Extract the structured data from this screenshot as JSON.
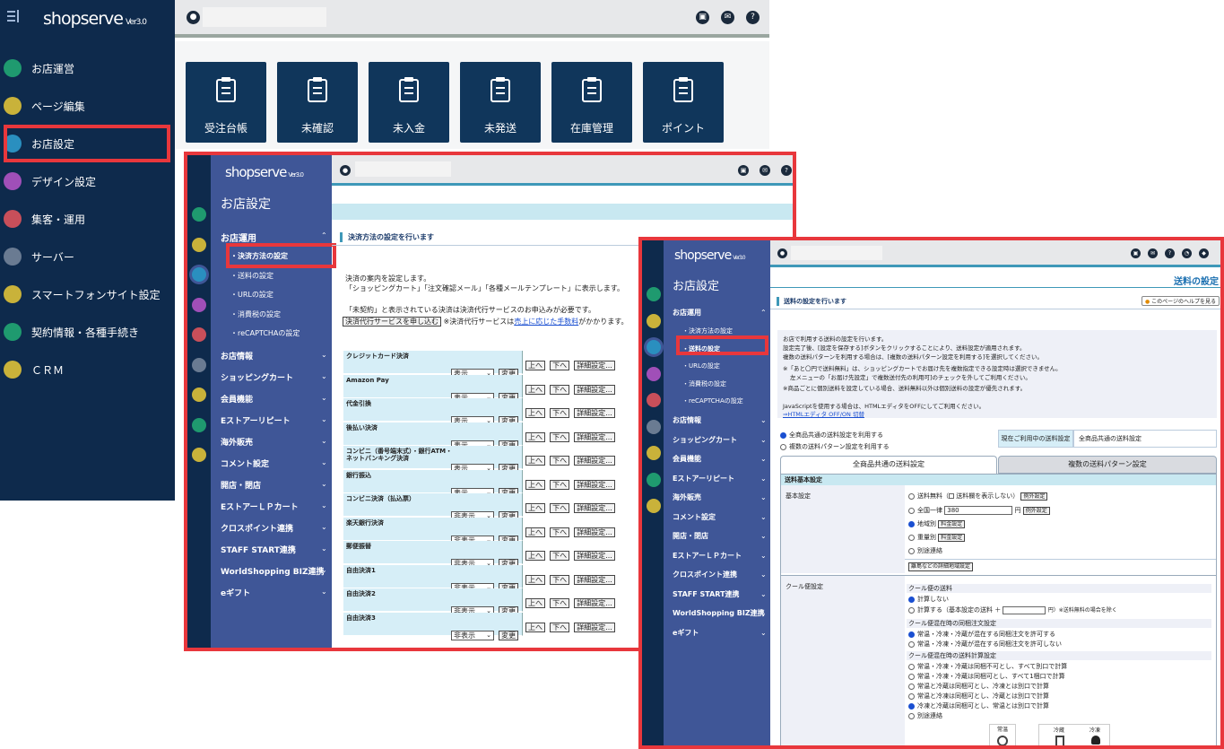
{
  "main": {
    "logo": "shopserve",
    "logo_ver": "Ver3.0",
    "sidebar": [
      {
        "label": "お店運営",
        "color": "#1f9a6f"
      },
      {
        "label": "ページ編集",
        "color": "#c9b23a"
      },
      {
        "label": "お店設定",
        "color": "#2a8fbf"
      },
      {
        "label": "デザイン設定",
        "color": "#a04fb8"
      },
      {
        "label": "集客・運用",
        "color": "#c84f5a"
      },
      {
        "label": "サーバー",
        "color": "#6a7b92"
      },
      {
        "label": "スマートフォンサイト設定",
        "color": "#c9b23a"
      },
      {
        "label": "契約情報・各種手続き",
        "color": "#1f9a6f"
      },
      {
        "label": "ＣＲＭ",
        "color": "#c9b23a"
      }
    ],
    "tiles": [
      "受注台帳",
      "未確認",
      "未入金",
      "未発送",
      "在庫管理",
      "ポイント"
    ]
  },
  "s1": {
    "logo": "shopserve",
    "logo_ver": "Ver3.0",
    "section": "お店設定",
    "group": "お店運用",
    "sub": [
      "決済方法の設定",
      "送料の設定",
      "URLの設定",
      "消費税の設定",
      "reCAPTCHAの設定"
    ],
    "nav": [
      "お店情報",
      "ショッピングカート",
      "会員機能",
      "Eストアーリピート",
      "海外販売",
      "コメント設定",
      "開店・閉店",
      "EストアーＬＰカート",
      "クロスポイント連携",
      "STAFF START連携",
      "WorldShopping BIZ連携",
      "eギフト"
    ],
    "heading": "決済方法の設定を行います",
    "intro1": "決済の案内を設定します。",
    "intro2": "「ショッピングカート」「注文確認メール」「各種メールテンプレート」に表示します。",
    "notice": "「未契約」と表示されている決済は決済代行サービスのお申込みが必要です。",
    "apply_btn": "決済代行サービスを申し込む",
    "notice2": "※決済代行サービスは",
    "notice_link": "売上に応じた手数料",
    "notice3": "がかかります。",
    "btn_up": "上へ",
    "btn_down": "下へ",
    "btn_detail": "詳細設定...",
    "btn_change": "変更",
    "payments": [
      {
        "name": "クレジットカード決済",
        "status": "表示"
      },
      {
        "name": "Amazon Pay",
        "status": "表示"
      },
      {
        "name": "代金引換",
        "status": "表示"
      },
      {
        "name": "後払い決済",
        "status": "表示"
      },
      {
        "name": "コンビニ（番号端末式）・銀行ATM・ネットバンキング決済",
        "status": "表示"
      },
      {
        "name": "銀行振込",
        "status": "表示"
      },
      {
        "name": "コンビニ決済（払込票）",
        "status": "非表示"
      },
      {
        "name": "楽天銀行決済",
        "status": "非表示"
      },
      {
        "name": "郵便振替",
        "status": "非表示"
      },
      {
        "name": "自由決済1",
        "status": "非表示"
      },
      {
        "name": "自由決済2",
        "status": "非表示"
      },
      {
        "name": "自由決済3",
        "status": "非表示"
      }
    ]
  },
  "s2": {
    "logo": "shopserve",
    "logo_ver": "Ver3.0",
    "section": "お店設定",
    "page_title": "送料の設定",
    "group": "お店運用",
    "sub": [
      "決済方法の設定",
      "送料の設定",
      "URLの設定",
      "消費税の設定",
      "reCAPTCHAの設定"
    ],
    "nav": [
      "お店情報",
      "ショッピングカート",
      "会員機能",
      "Eストアーリピート",
      "海外販売",
      "コメント設定",
      "開店・閉店",
      "EストアーＬＰカート",
      "クロスポイント連携",
      "STAFF START連携",
      "WorldShopping BIZ連携",
      "eギフト"
    ],
    "heading": "送料の設定を行います",
    "help": "このページのヘルプを見る",
    "desc": [
      "お店で利用する送料の設定を行います。",
      "設定完了後、[設定を保存する]ボタンをクリックすることにより、送料設定が適用されます。",
      "複数の送料パターンを利用する場合は、[複数の送料パターン設定を利用する]を選択してください。",
      "※「あと〇円で送料無料」は、ショッピングカートでお届け先を複数指定できる設定時は選択できません。",
      "左メニューの「お届け先設定」で複数送付先の利用可]のチェックを外してご利用ください。",
      "※商品ごとに個別送料を設定している場合、送料無料以外は個別送料の設定が優先されます。",
      "JavaScriptを使用する場合は、HTMLエディタをOFFにしてご利用ください。"
    ],
    "editor_link": "⇒HTMLエディタ OFF/ON 切替",
    "opt_common": "全商品共通の送料設定を利用する",
    "opt_multi": "複数の送料パターン設定を利用する",
    "current_label": "現在ご利用中の送料設定",
    "current_value": "全商品共通の送料設定",
    "tab_common": "全商品共通の送料設定",
    "tab_multi": "複数の送料パターン設定",
    "basic_header": "送料基本設定",
    "basic_label": "基本設定",
    "opt_free": "送料無料（",
    "opt_free_hide": "送料欄を表示しない）",
    "btn_exception": "例外設定",
    "opt_flat": "全国一律",
    "flat_value": "380",
    "yen": "円",
    "opt_region": "地域別",
    "btn_fee": "料金設定",
    "opt_weight": "重量別",
    "opt_separate": "別途連絡",
    "btn_remote": "離島などの詳細地域設定",
    "cool_label": "クール便設定",
    "cool_fee_title": "クール便の送料",
    "cool_none": "計算しない",
    "cool_calc": "計算する（基本設定の送料 ＋",
    "cool_calc_tail": "円）※送料無料の場合を除く",
    "mix_title": "クール便混在時の同梱注文設定",
    "mix_allow": "常温・冷凍・冷蔵が混在する同梱注文を許可する",
    "mix_deny": "常温・冷凍・冷蔵が混在する同梱注文を許可しない",
    "calc_title": "クール便混在時の送料計算設定",
    "calc_opts": [
      "常温・冷凍・冷蔵は同梱不可とし、すべて別口で計算",
      "常温・冷凍・冷蔵は同梱可とし、すべて1梱口で計算",
      "常温と冷蔵は同梱可とし、冷凍とは別口で計算",
      "常温と冷凍は同梱可とし、冷蔵とは別口で計算",
      "冷凍と冷蔵は同梱可とし、常温とは別口で計算",
      "別途連絡"
    ],
    "temp_labels": [
      "常温",
      "冷蔵",
      "冷凍"
    ]
  }
}
